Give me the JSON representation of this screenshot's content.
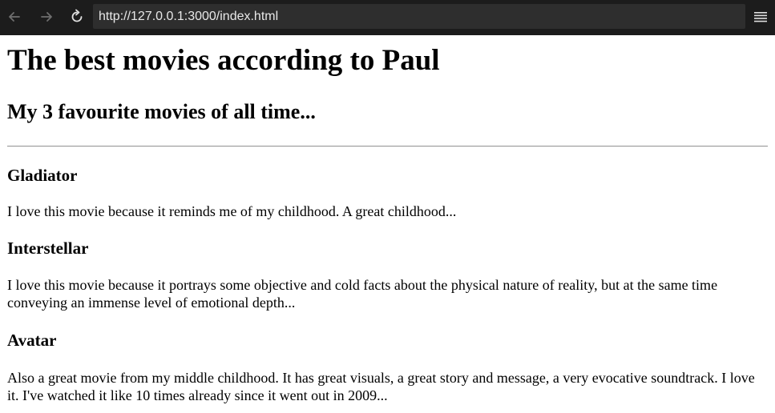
{
  "browser": {
    "url": "http://127.0.0.1:3000/index.html",
    "back_icon": "arrow-left-icon",
    "forward_icon": "arrow-right-icon",
    "reload_icon": "reload-icon",
    "menu_icon": "hamburger-menu-icon",
    "toolbar_color": "#1c1c1c",
    "url_bar_color": "#2e2e2e"
  },
  "page": {
    "title": "The best movies according to Paul",
    "subtitle": "My 3 favourite movies of all time...",
    "movies": [
      {
        "name": "Gladiator",
        "description": "I love this movie because it reminds me of my childhood. A great childhood..."
      },
      {
        "name": "Interstellar",
        "description": "I love this movie because it portrays some objective and cold facts about the physical nature of reality, but at the same time conveying an immense level of emotional depth..."
      },
      {
        "name": "Avatar",
        "description": "Also a great movie from my middle childhood. It has great visuals, a great story and message, a very evocative soundtrack. I love it. I've watched it like 10 times already since it went out in 2009..."
      }
    ]
  }
}
